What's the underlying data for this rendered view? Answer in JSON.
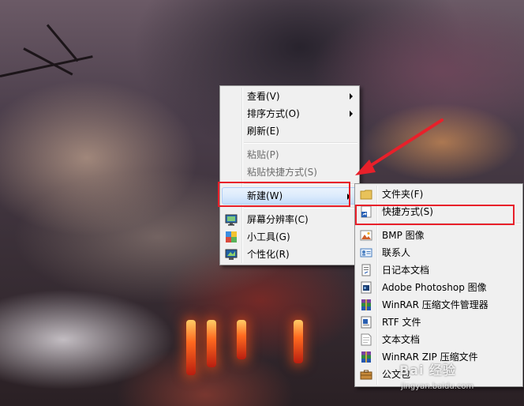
{
  "desktop_menu": {
    "items": [
      {
        "label": "查看(V)",
        "submenu": true,
        "disabled": false
      },
      {
        "label": "排序方式(O)",
        "submenu": true,
        "disabled": false
      },
      {
        "label": "刷新(E)",
        "submenu": false,
        "disabled": false
      },
      {
        "label": "粘贴(P)",
        "submenu": false,
        "disabled": true
      },
      {
        "label": "粘贴快捷方式(S)",
        "submenu": false,
        "disabled": true
      },
      {
        "label": "新建(W)",
        "submenu": true,
        "disabled": false,
        "highlighted": true
      },
      {
        "label": "屏幕分辨率(C)",
        "icon": "monitor-icon"
      },
      {
        "label": "小工具(G)",
        "icon": "gadgets-icon"
      },
      {
        "label": "个性化(R)",
        "icon": "personalize-icon"
      }
    ]
  },
  "new_submenu": {
    "items": [
      {
        "label": "文件夹(F)",
        "icon": "folder-icon"
      },
      {
        "label": "快捷方式(S)",
        "icon": "shortcut-icon",
        "annotated": true
      },
      {
        "label": "BMP 图像",
        "icon": "bmp-image-icon"
      },
      {
        "label": "联系人",
        "icon": "contact-icon"
      },
      {
        "label": "日记本文档",
        "icon": "journal-icon"
      },
      {
        "label": "Adobe Photoshop 图像",
        "icon": "photoshop-icon"
      },
      {
        "label": "WinRAR 压缩文件管理器",
        "icon": "winrar-icon"
      },
      {
        "label": "RTF 文件",
        "icon": "rtf-icon"
      },
      {
        "label": "文本文档",
        "icon": "text-document-icon"
      },
      {
        "label": "WinRAR ZIP 压缩文件",
        "icon": "winrar-zip-icon"
      },
      {
        "label": "公文包",
        "icon": "briefcase-icon"
      }
    ]
  },
  "watermark": {
    "text": "Bai 经验",
    "sub": "jingyan.baidu.com"
  },
  "colors": {
    "annotation": "#e8202a",
    "menu_bg": "#f0f0f0",
    "highlight": "#dcebfc"
  }
}
